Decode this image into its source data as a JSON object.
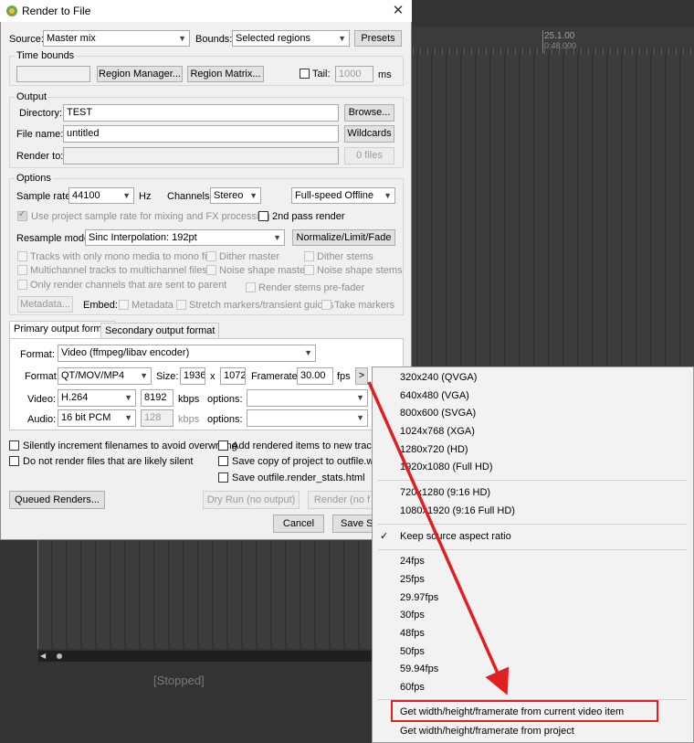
{
  "dialog": {
    "title": "Render to File",
    "close": "✕",
    "source_label": "Source:",
    "source_value": "Master mix",
    "bounds_label": "Bounds:",
    "bounds_value": "Selected regions",
    "presets": "Presets",
    "time_bounds": "Time bounds",
    "region_manager": "Region Manager...",
    "region_matrix": "Region Matrix...",
    "tail_label": "Tail:",
    "tail_value": "1000",
    "tail_unit": "ms",
    "output": "Output",
    "directory_label": "Directory:",
    "directory_value": "TEST",
    "browse": "Browse...",
    "filename_label": "File name:",
    "filename_value": "untitled",
    "wildcards": "Wildcards",
    "renderto_label": "Render to:",
    "files_count": "0 files",
    "options": "Options",
    "sample_rate_label": "Sample rate:",
    "sample_rate_value": "44100",
    "hz": "Hz",
    "channels_label": "Channels:",
    "channels_value": "Stereo",
    "speed_value": "Full-speed Offline",
    "use_project_sr": "Use project sample rate for mixing and FX processing",
    "second_pass": "2nd pass render",
    "resample_label": "Resample mode:",
    "resample_value": "Sinc Interpolation: 192pt",
    "normalize": "Normalize/Limit/Fade",
    "mono_tracks": "Tracks with only mono media to mono file",
    "dither_master": "Dither master",
    "dither_stems": "Dither stems",
    "multichannel": "Multichannel tracks to multichannel files",
    "noise_master": "Noise shape master",
    "noise_stems": "Noise shape stems",
    "only_render_channels": "Only render channels that are sent to parent",
    "stems_prefader": "Render stems pre-fader",
    "metadata_btn": "Metadata...",
    "embed_label": "Embed:",
    "embed_metadata": "Metadata",
    "stretch_markers": "Stretch markers/transient guides",
    "take_markers": "Take markers",
    "tab_primary": "Primary output format",
    "tab_secondary": "Secondary output format",
    "format_label": "Format:",
    "format_value": "Video (ffmpeg/libav encoder)",
    "container_label": "Format:",
    "container_value": "QT/MOV/MP4",
    "size_label": "Size:",
    "width": "1936",
    "x": "x",
    "height": "1072",
    "framerate_label": "Framerate:",
    "framerate_value": "30.00",
    "fps": "fps",
    "more": ">",
    "video_label": "Video:",
    "video_codec": "H.264",
    "video_kbps": "8192",
    "kbps": "kbps",
    "options_label": "options:",
    "audio_label": "Audio:",
    "audio_codec": "16 bit PCM",
    "audio_kbps": "128",
    "silently_increment": "Silently increment filenames to avoid overwriting",
    "do_not_render": "Do not render files that are likely silent",
    "add_rendered": "Add rendered items to new tracks in",
    "save_copy": "Save copy of project to outfile.wav.l",
    "save_stats": "Save outfile.render_stats.html",
    "queued": "Queued Renders...",
    "dry_run": "Dry Run (no output)",
    "render": "Render (no f",
    "cancel": "Cancel",
    "save_settings": "Save Se"
  },
  "background": {
    "ruler_time": "25.1.00",
    "ruler_sub": "0:48.000",
    "status": "[Stopped]"
  },
  "menu": {
    "items": [
      "320x240 (QVGA)",
      "640x480 (VGA)",
      "800x600 (SVGA)",
      "1024x768 (XGA)",
      "1280x720 (HD)",
      "1920x1080 (Full HD)",
      "720x1280 (9:16 HD)",
      "1080x1920 (9:16 Full HD)",
      "Keep source aspect ratio",
      "24fps",
      "25fps",
      "29.97fps",
      "30fps",
      "48fps",
      "50fps",
      "59.94fps",
      "60fps",
      "Get width/height/framerate from current video item",
      "Get width/height/framerate from project"
    ],
    "check": "✓",
    "highlight_color": "#e02020"
  }
}
